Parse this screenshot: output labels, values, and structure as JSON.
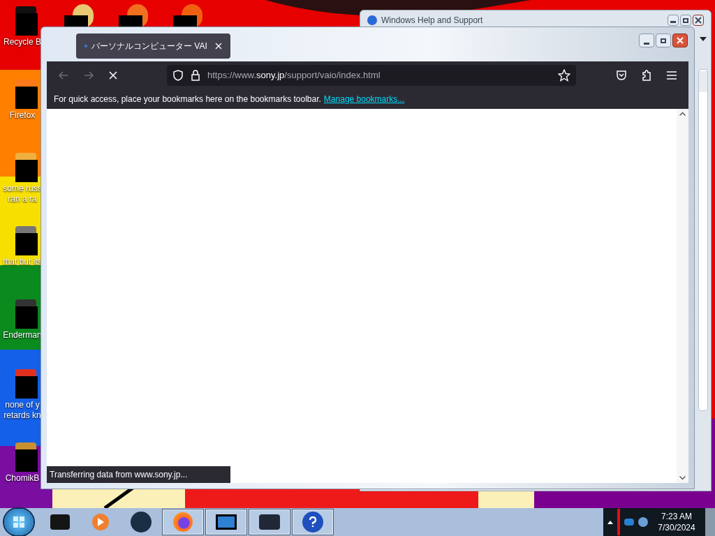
{
  "desktop_icons": [
    {
      "label": [
        "Recycle B"
      ]
    },
    {
      "label": [
        "Firefox"
      ]
    },
    {
      "label": [
        "some russ",
        "ran a ra"
      ]
    },
    {
      "label": [
        "that but its"
      ]
    },
    {
      "label": [
        "Enderman"
      ]
    },
    {
      "label": [
        "none of y",
        "retards kn"
      ]
    },
    {
      "label": [
        "ChomikB"
      ]
    }
  ],
  "background_window": {
    "title": "Windows Help and Support"
  },
  "browser": {
    "tab": {
      "title": "パーソナルコンピューター VAI",
      "selected": true
    },
    "nav": [
      {
        "kind": "back",
        "disabled": true
      },
      {
        "kind": "forward",
        "disabled": true
      },
      {
        "kind": "stop",
        "disabled": false
      }
    ],
    "url": {
      "scheme": "https://www.",
      "domain": "sony.jp",
      "path": "/support/vaio/index.html"
    },
    "bookmarks_bar": {
      "message": "For quick access, place your bookmarks here on the bookmarks toolbar.",
      "link": "Manage bookmarks..."
    },
    "status": "Transferring data from www.sony.jp..."
  },
  "taskbar": {
    "items": [
      {
        "kind": "pinned"
      },
      {
        "kind": "pinned"
      },
      {
        "kind": "pinned"
      },
      {
        "kind": "window"
      },
      {
        "kind": "window"
      },
      {
        "kind": "window"
      },
      {
        "kind": "window"
      }
    ],
    "clock": {
      "time": "7:23 AM",
      "date": "7/30/2024"
    }
  }
}
